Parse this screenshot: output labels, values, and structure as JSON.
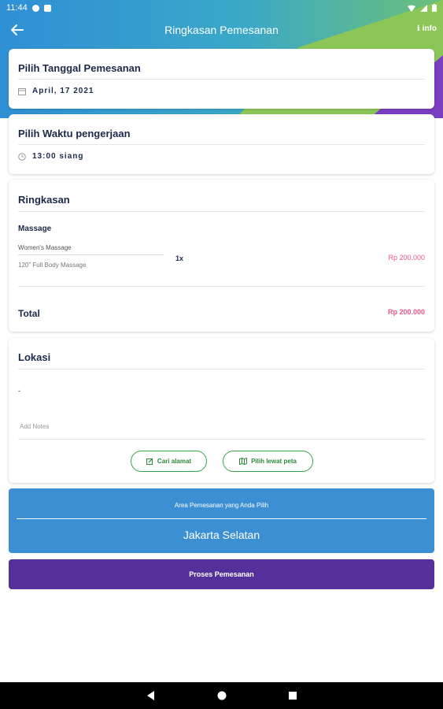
{
  "status_bar": {
    "time": "11:44"
  },
  "app_bar": {
    "title": "Ringkasan Pemesanan",
    "info_label": "info",
    "info_icon": "info-icon"
  },
  "date_section": {
    "title": "Pilih Tanggal Pemesanan",
    "value": "April, 17 2021",
    "icon": "calendar-icon"
  },
  "time_section": {
    "title": "Pilih Waktu pengerjaan",
    "value": "13:00 siang",
    "icon": "clock-icon"
  },
  "summary": {
    "title": "Ringkasan",
    "category": "Massage",
    "item_name": "Women's Massage",
    "item_detail": "120\" Full Body Massage",
    "quantity": "1x",
    "price": "Rp 200.000",
    "total_label": "Total",
    "total_price": "Rp 200.000"
  },
  "location": {
    "title": "Lokasi",
    "address": "-",
    "notes_placeholder": "Add Notes",
    "search_button": "Cari alamat",
    "map_button": "Pilih lewat peta"
  },
  "area": {
    "label": "Area Pemesanan yang Anda Pilih",
    "value": "Jakarta Selatan"
  },
  "process_button": "Proses Pemesanan",
  "colors": {
    "blue": "#3d8fd3",
    "green": "#8cc657",
    "purple": "#55309a",
    "pink": "#e8588a",
    "button_green": "#3aa14a"
  }
}
